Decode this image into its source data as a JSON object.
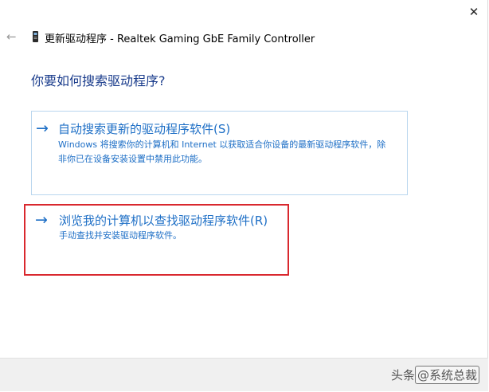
{
  "window": {
    "title": "更新驱动程序 - Realtek Gaming GbE Family Controller",
    "close_glyph": "✕",
    "back_glyph": "←"
  },
  "question": "你要如何搜索驱动程序?",
  "options": [
    {
      "arrow": "→",
      "title": "自动搜索更新的驱动程序软件(S)",
      "description": "Windows 将搜索你的计算机和 Internet 以获取适合你设备的最新驱动程序软件，除非你已在设备安装设置中禁用此功能。"
    },
    {
      "arrow": "→",
      "title": "浏览我的计算机以查找驱动程序软件(R)",
      "description": "手动查找并安装驱动程序软件。",
      "highlight_color": "#d9282e"
    }
  ],
  "watermark": {
    "prefix": "头条",
    "at": "@",
    "name": "系统总裁"
  },
  "colors": {
    "link_blue": "#1e6fc6",
    "heading_blue": "#1a3c8c",
    "option_border": "#b9d6ee",
    "footer_bg": "#f0f0f0"
  },
  "icons": {
    "back": "arrow-left-icon",
    "device": "network-adapter-icon",
    "close": "close-icon"
  }
}
